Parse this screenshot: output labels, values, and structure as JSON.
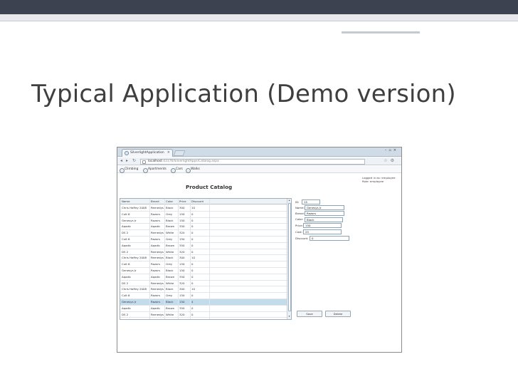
{
  "slide": {
    "title": "Typical Application (Demo version)"
  },
  "browser": {
    "tab_title": "SilverlightApplication",
    "tab_close": "×",
    "url_host": "localhost",
    "url_path": ":43176/SilverlightApps/Catalog.aspx",
    "bookmarks": [
      "Climbing",
      "Apartments",
      "Cars",
      "Walks"
    ]
  },
  "app": {
    "login_line1": "Logged in as: employee",
    "login_line2": "Role: employee",
    "page_title": "Product Catalog",
    "columns": [
      "Name",
      "Brand",
      "Color",
      "Price",
      "Discount"
    ],
    "rows": [
      [
        "Chris Haffey 2008",
        "Remedys",
        "Black",
        "300",
        "10"
      ],
      [
        "Cult 6",
        "Razors",
        "Grey",
        "150",
        "0"
      ],
      [
        "Genesys Jr",
        "Razors",
        "Black",
        "150",
        "0"
      ],
      [
        "Aqadic",
        "Aqadic",
        "Brown",
        "350",
        "0"
      ],
      [
        "DS 2",
        "Remedys",
        "White",
        "320",
        "0"
      ],
      [
        "Cult 6",
        "Razors",
        "Grey",
        "150",
        "0"
      ],
      [
        "Aqadic",
        "Aqadic",
        "Brown",
        "350",
        "0"
      ],
      [
        "DS 2",
        "Remedys",
        "White",
        "320",
        "0"
      ],
      [
        "Chris Haffey 2008",
        "Remedys",
        "Black",
        "300",
        "10"
      ],
      [
        "Cult 6",
        "Razors",
        "Grey",
        "150",
        "0"
      ],
      [
        "Genesys Jr",
        "Razors",
        "Black",
        "150",
        "0"
      ],
      [
        "Aqadic",
        "Aqadic",
        "Brown",
        "350",
        "0"
      ],
      [
        "DS 2",
        "Remedys",
        "White",
        "320",
        "0"
      ],
      [
        "Chris Haffey 2008",
        "Remedys",
        "Black",
        "300",
        "10"
      ],
      [
        "Cult 6",
        "Razors",
        "Grey",
        "150",
        "0"
      ],
      [
        "Genesys Jr",
        "Razors",
        "Black",
        "150",
        "4"
      ],
      [
        "Aqadic",
        "Aqadic",
        "Brown",
        "350",
        "0"
      ],
      [
        "DS 2",
        "Remedys",
        "White",
        "320",
        "0"
      ]
    ],
    "selected_row": 15,
    "form": {
      "id_label": "ID:",
      "id_value": "15",
      "name_label": "Name:",
      "name_value": "Genesys Jr",
      "brand_label": "Brand:",
      "brand_value": "Razors",
      "color_label": "Color:",
      "color_value": "Black",
      "price_label": "Price:",
      "price_value": "150",
      "cost_label": "Cost:",
      "cost_value": "25",
      "discount_label": "Discount:",
      "discount_value": "0"
    },
    "save_label": "Save",
    "delete_label": "Delete"
  },
  "colors": {
    "slide_band": "#3d4250",
    "selection": "#c3dcec",
    "grid_border": "#9eb0c0"
  }
}
